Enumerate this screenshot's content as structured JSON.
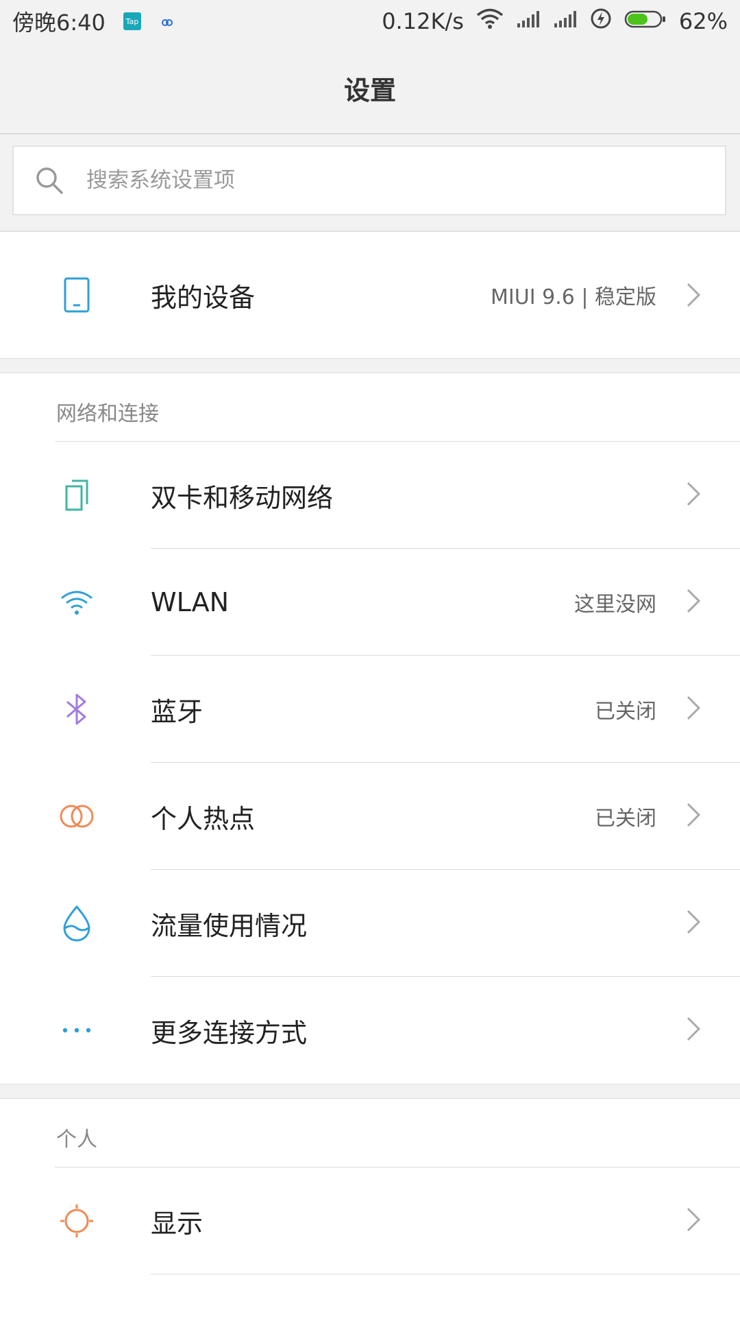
{
  "status_bar": {
    "time": "傍晚6:40",
    "app1_label": "Tap",
    "net_speed": "0.12K/s",
    "battery_percent": "62%",
    "battery_level": 62,
    "icons": [
      "tap-app-icon",
      "notification-app-icon",
      "wifi-icon",
      "signal-sim1-icon",
      "signal-sim2-icon",
      "charging-icon",
      "battery-icon"
    ]
  },
  "title": "设置",
  "search": {
    "placeholder": "搜索系统设置项"
  },
  "my_device": {
    "label": "我的设备",
    "value": "MIUI 9.6 | 稳定版",
    "icon": "phone-icon"
  },
  "sections": {
    "network": {
      "title": "网络和连接",
      "items": [
        {
          "label": "双卡和移动网络",
          "value": "",
          "icon": "dual-sim-icon",
          "color": "#3fb6a0"
        },
        {
          "label": "WLAN",
          "value": "这里没网",
          "icon": "wifi-icon",
          "color": "#2e9fd8"
        },
        {
          "label": "蓝牙",
          "value": "已关闭",
          "icon": "bluetooth-icon",
          "color": "#a07be0"
        },
        {
          "label": "个人热点",
          "value": "已关闭",
          "icon": "hotspot-icon",
          "color": "#ef8a55"
        },
        {
          "label": "流量使用情况",
          "value": "",
          "icon": "data-usage-icon",
          "color": "#2e9fd8"
        },
        {
          "label": "更多连接方式",
          "value": "",
          "icon": "more-icon",
          "color": "#2e9fd8"
        }
      ]
    },
    "personal": {
      "title": "个人",
      "items": [
        {
          "label": "显示",
          "value": "",
          "icon": "display-brightness-icon",
          "color": "#ef8a55"
        }
      ]
    }
  },
  "colors": {
    "accent_blue": "#2e9fd8",
    "battery_green": "#4cc31a",
    "background": "#f2f2f2"
  }
}
